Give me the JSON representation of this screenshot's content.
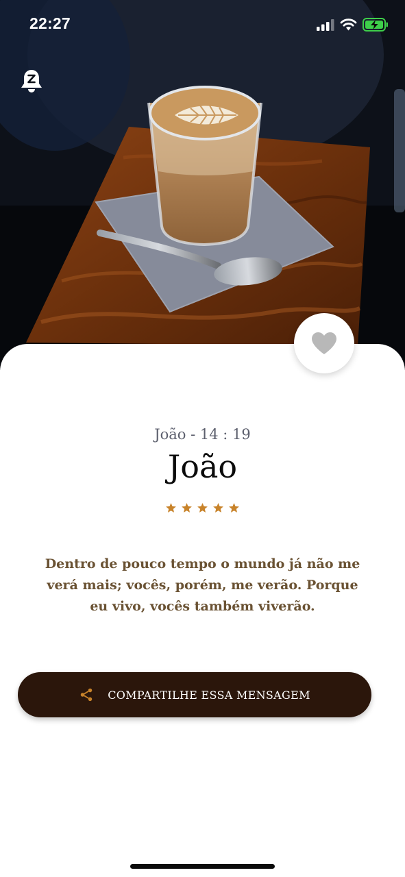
{
  "status_bar": {
    "time": "22:27"
  },
  "verse": {
    "reference": "João - 14 : 19",
    "book": "João",
    "rating": 5,
    "text": "Dentro de pouco tempo o mundo já não me verá mais; vocês, porém, me verão. Porque eu vivo, vocês também viverão."
  },
  "actions": {
    "share_label": "COMPARTILHE ESSA MENSAGEM"
  },
  "icons": {
    "bell": "bell-z-icon",
    "favorite": "heart-icon",
    "share": "share-icon",
    "rating_star": "star-icon"
  },
  "colors": {
    "accent": "#c8832a",
    "button_background": "#2b160b",
    "verse_text": "#6a5233",
    "reference_text": "#5b5e6c",
    "battery": "#3ecf4a"
  }
}
